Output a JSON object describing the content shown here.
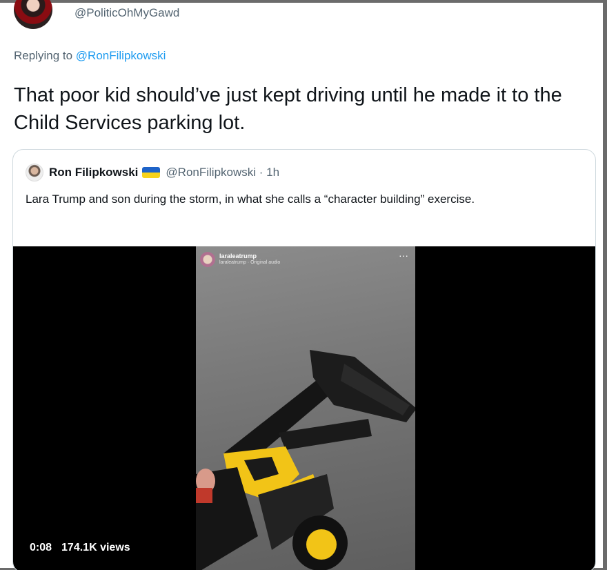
{
  "tweet": {
    "handle": "@PoliticOhMyGawd",
    "replying_prefix": "Replying to",
    "replying_to": "@RonFilipkowski",
    "text": "That poor kid should’ve just kept driving until he made it to the Child Services parking lot."
  },
  "quote": {
    "name": "Ron Filipkowski",
    "flag_icon": "ukraine-flag-icon",
    "handle_time": "@RonFilipkowski · 1h",
    "text": "Lara Trump and son during the storm, in what she calls a “character building” exercise.",
    "video": {
      "overlay_user": "laraleatrump",
      "overlay_sub": "laraleatrump · Original audio",
      "more_icon": "more-dots-icon",
      "time": "0:08",
      "views": "174.1K views"
    }
  },
  "colors": {
    "link": "#1d9bf0",
    "secondary_text": "#536471",
    "border": "#cfd9de",
    "toy_yellow": "#f2c417"
  }
}
